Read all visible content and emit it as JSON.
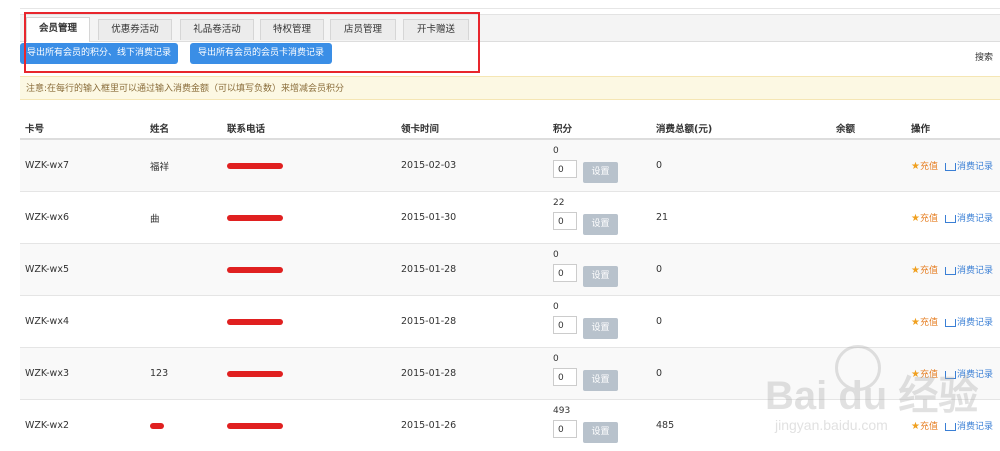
{
  "tabs": [
    "会员管理",
    "优惠券活动",
    "礼品卷活动",
    "特权管理",
    "店员管理",
    "开卡赠送"
  ],
  "buttons": {
    "export_points": "导出所有会员的积分、线下消费记录",
    "export_card": "导出所有会员的会员卡消费记录"
  },
  "search_label": "搜索",
  "notice": "注意:在每行的输入框里可以通过输入消费金额（可以填写负数）来增减会员积分",
  "table": {
    "headers": [
      "卡号",
      "姓名",
      "联系电话",
      "领卡时间",
      "积分",
      "消费总额(元)",
      "余额",
      "操作"
    ],
    "rows": [
      {
        "card": "WZK-wx7",
        "name": "福祥",
        "date": "2015-02-03",
        "points": "0",
        "input": "0",
        "total": "0"
      },
      {
        "card": "WZK-wx6",
        "name": "曲",
        "date": "2015-01-30",
        "points": "22",
        "input": "0",
        "total": "21"
      },
      {
        "card": "WZK-wx5",
        "name": "",
        "date": "2015-01-28",
        "points": "0",
        "input": "0",
        "total": "0"
      },
      {
        "card": "WZK-wx4",
        "name": "",
        "date": "2015-01-28",
        "points": "0",
        "input": "0",
        "total": "0"
      },
      {
        "card": "WZK-wx3",
        "name": "123",
        "date": "2015-01-28",
        "points": "0",
        "input": "0",
        "total": "0"
      },
      {
        "card": "WZK-wx2",
        "name": "",
        "date": "2015-01-26",
        "points": "493",
        "input": "0",
        "total": "485"
      }
    ],
    "set_label": "设置",
    "charge_label": "充值",
    "record_label": "消费记录"
  },
  "watermark": {
    "main": "Bai du 经验",
    "sub": "jingyan.baidu.com"
  }
}
